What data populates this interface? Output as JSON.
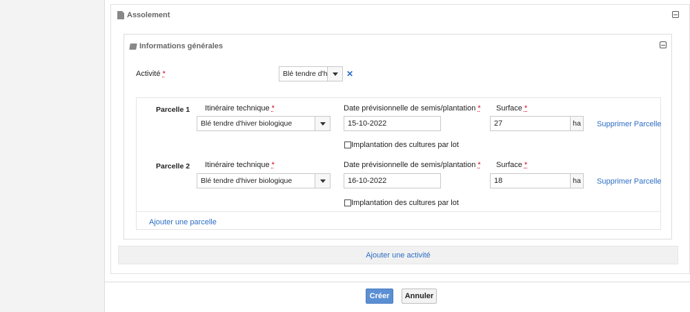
{
  "assolement": {
    "title": "Assolement"
  },
  "info": {
    "title": "Informations générales"
  },
  "activity": {
    "label": "Activité",
    "value": "Blé tendre d'hiv",
    "clear": "✕"
  },
  "parcels": [
    {
      "title": "Parcelle 1",
      "itinerary_label": "Itinéraire technique",
      "itinerary_value": "Blé tendre d'hiver biologique",
      "date_label": "Date prévisionnelle de semis/plantation",
      "date_value": "15-10-2022",
      "surface_label": "Surface",
      "surface_value": "27",
      "unit": "ha",
      "delete": "Supprimer Parcelle",
      "lot_label": "Implantation des cultures par lot"
    },
    {
      "title": "Parcelle 2",
      "itinerary_label": "Itinéraire technique",
      "itinerary_value": "Blé tendre d'hiver biologique",
      "date_label": "Date prévisionnelle de semis/plantation",
      "date_value": "16-10-2022",
      "surface_label": "Surface",
      "surface_value": "18",
      "unit": "ha",
      "delete": "Supprimer Parcelle",
      "lot_label": "Implantation des cultures par lot"
    }
  ],
  "required_marker": "*",
  "add_parcel": "Ajouter une parcelle",
  "add_activity": "Ajouter une activité",
  "buttons": {
    "create": "Créer",
    "cancel": "Annuler"
  },
  "colors": {
    "link": "#2b6cc4",
    "primary": "#5b8fd4",
    "required": "#d0021b"
  }
}
